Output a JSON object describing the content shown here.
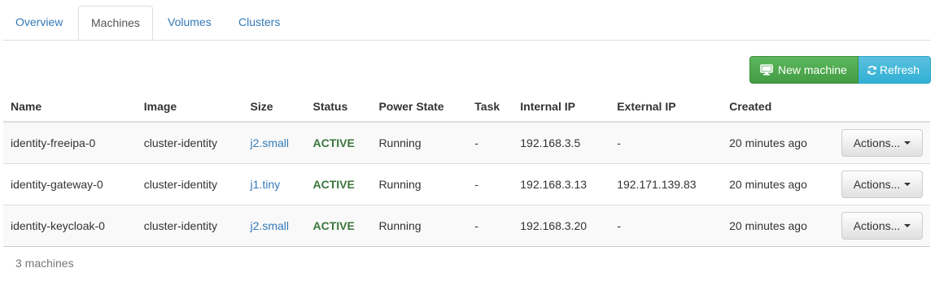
{
  "tabs": [
    {
      "label": "Overview",
      "active": false
    },
    {
      "label": "Machines",
      "active": true
    },
    {
      "label": "Volumes",
      "active": false
    },
    {
      "label": "Clusters",
      "active": false
    }
  ],
  "toolbar": {
    "new_machine_label": "New machine",
    "new_machine_icon": "desktop-icon",
    "refresh_label": "Refresh",
    "refresh_icon": "refresh-icon",
    "colors": {
      "new_machine": "#5cb85c",
      "refresh": "#5bc0de"
    }
  },
  "table": {
    "columns": [
      "Name",
      "Image",
      "Size",
      "Status",
      "Power State",
      "Task",
      "Internal IP",
      "External IP",
      "Created"
    ],
    "rows": [
      {
        "name": "identity-freeipa-0",
        "image": "cluster-identity",
        "size": "j2.small",
        "status": "ACTIVE",
        "power_state": "Running",
        "task": "-",
        "internal_ip": "192.168.3.5",
        "external_ip": "-",
        "created": "20 minutes ago",
        "actions_label": "Actions..."
      },
      {
        "name": "identity-gateway-0",
        "image": "cluster-identity",
        "size": "j1.tiny",
        "status": "ACTIVE",
        "power_state": "Running",
        "task": "-",
        "internal_ip": "192.168.3.13",
        "external_ip": "192.171.139.83",
        "created": "20 minutes ago",
        "actions_label": "Actions..."
      },
      {
        "name": "identity-keycloak-0",
        "image": "cluster-identity",
        "size": "j2.small",
        "status": "ACTIVE",
        "power_state": "Running",
        "task": "-",
        "internal_ip": "192.168.3.20",
        "external_ip": "-",
        "created": "20 minutes ago",
        "actions_label": "Actions..."
      }
    ],
    "status_color": "#3c763d",
    "link_color": "#337ab7"
  },
  "footer": {
    "count_text": "3 machines"
  }
}
